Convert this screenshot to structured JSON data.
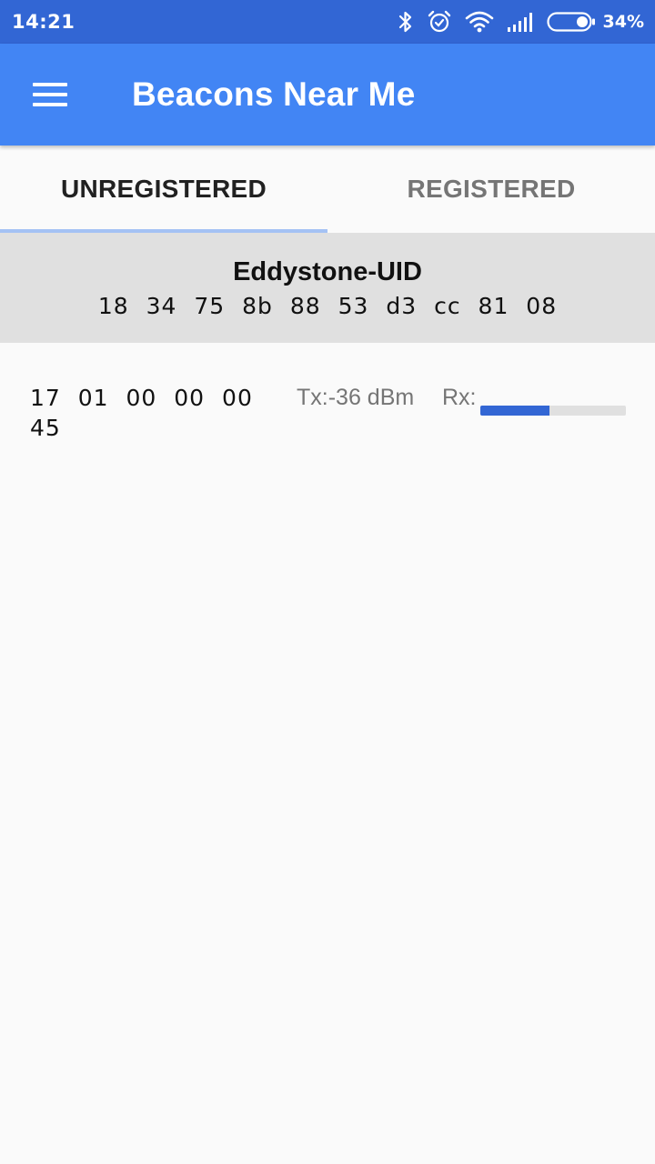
{
  "status_bar": {
    "time": "14:21",
    "battery_percent": "34%",
    "battery_level": 0.34,
    "icons": [
      "bluetooth-icon",
      "alarm-icon",
      "wifi-icon",
      "signal-icon",
      "battery-icon"
    ]
  },
  "app_bar": {
    "menu_icon": "hamburger-menu-icon",
    "title": "Beacons Near Me"
  },
  "tabs": [
    {
      "label": "UNREGISTERED",
      "active": true
    },
    {
      "label": "REGISTERED",
      "active": false
    }
  ],
  "beacon_group": {
    "type": "Eddystone-UID",
    "namespace": "18 34 75 8b 88 53 d3 cc 81 08"
  },
  "beacons": [
    {
      "instance": "17 01 00 00 00 45",
      "tx_label": "Tx:",
      "tx_value": "-36 dBm",
      "rx_label": "Rx:",
      "rx_level": 0.475
    }
  ],
  "colors": {
    "status_bar": "#3266d4",
    "app_bar": "#4285f4",
    "tab_indicator": "#a4c2f4",
    "group_header": "#e0e0e0",
    "rx_fill": "#3266d4"
  }
}
